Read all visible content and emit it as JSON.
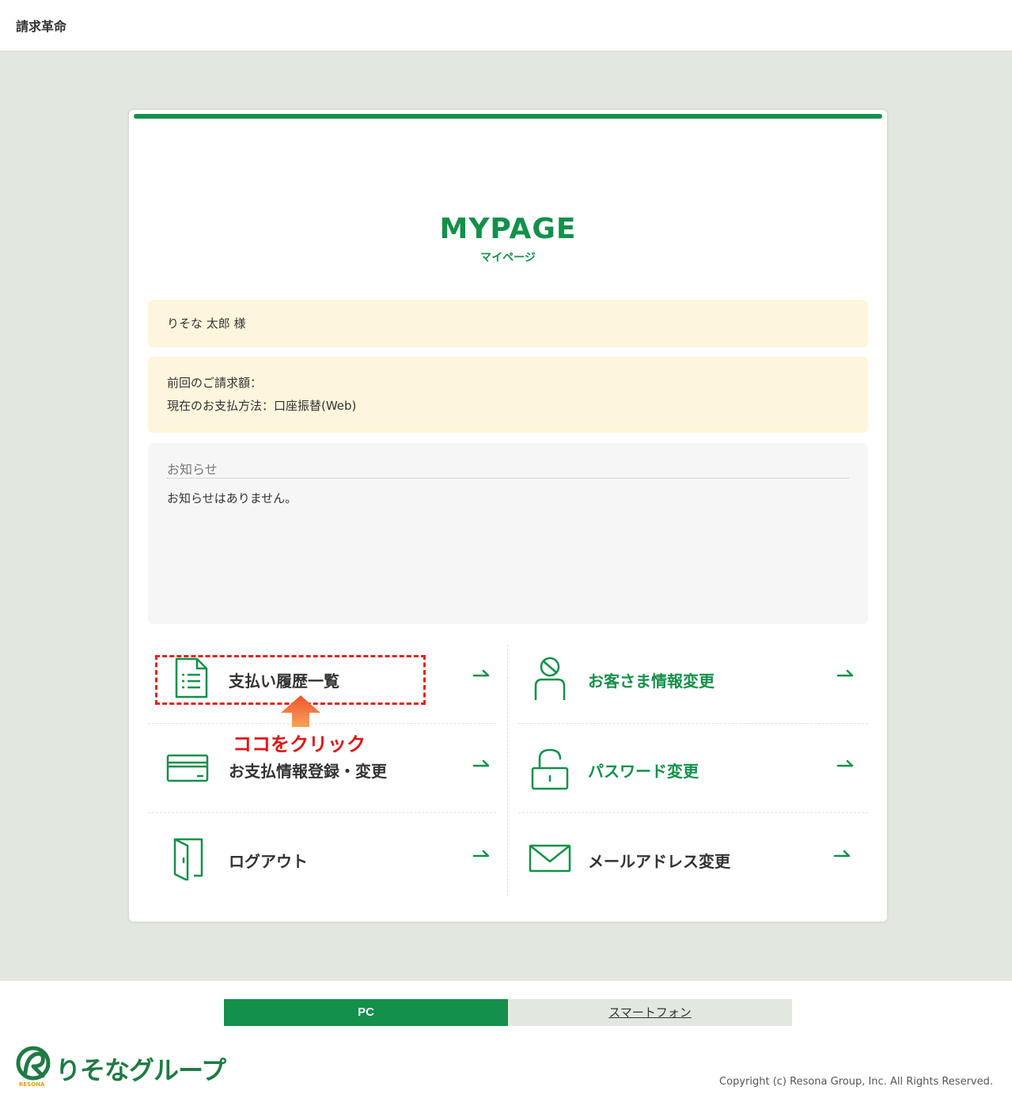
{
  "header": {
    "app_title": "請求革命"
  },
  "main": {
    "title": "MYPAGE",
    "subtitle": "マイページ",
    "customer_name": "りそな 太郎 様",
    "previous_billing_label": "前回のご請求額：",
    "payment_method_text": "現在のお支払方法：口座振替(Web)",
    "notice": {
      "title": "お知らせ",
      "body": "お知らせはありません。"
    }
  },
  "menu": {
    "payment_history": "支払い履歴一覧",
    "customer_info": "お客さま情報変更",
    "payment_register": "お支払情報登録・変更",
    "password_change": "パスワード変更",
    "logout": "ログアウト",
    "email_change": "メールアドレス変更"
  },
  "annotation": {
    "callout": "ココをクリック"
  },
  "footer": {
    "pc_label": "PC",
    "smartphone_label": "スマートフォン",
    "logo_text": "りそなグループ",
    "logo_sub": "RESONA",
    "copyright": "Copyright (c) Resona Group, Inc. All Rights Reserved."
  },
  "colors": {
    "brand_green": "#13904a",
    "highlight_red": "#e0241f",
    "background": "#e2e8e0"
  },
  "icons": [
    "document-list-icon",
    "person-icon",
    "credit-card-icon",
    "unlock-icon",
    "door-exit-icon",
    "envelope-icon",
    "arrow-right-icon"
  ]
}
